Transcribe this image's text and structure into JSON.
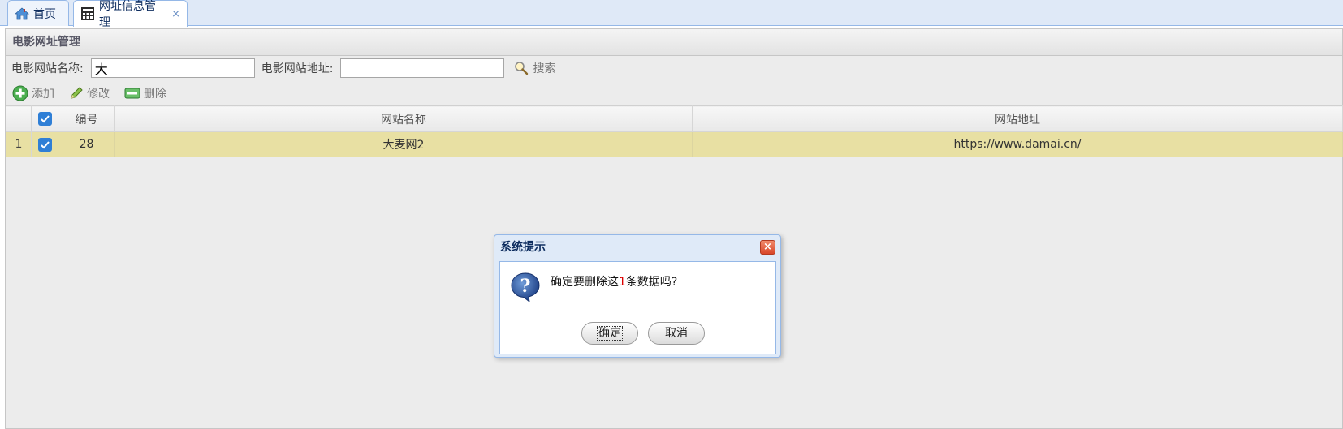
{
  "tabs": [
    {
      "label": "首页",
      "icon": "home-icon"
    },
    {
      "label": "网址信息管理",
      "icon": "grid-window-icon",
      "closable": "×"
    }
  ],
  "panel": {
    "title": "电影网址管理"
  },
  "search": {
    "name_label": "电影网站名称:",
    "name_value": "大",
    "url_label": "电影网站地址:",
    "url_value": "",
    "button_label": "搜索"
  },
  "toolbar": {
    "add_label": "添加",
    "edit_label": "修改",
    "delete_label": "删除"
  },
  "table": {
    "columns": [
      "编号",
      "网站名称",
      "网站地址"
    ],
    "rows": [
      {
        "rownum": "1",
        "checked": true,
        "id": "28",
        "name": "大麦网2",
        "url": "https://www.damai.cn/"
      }
    ]
  },
  "dialog": {
    "title": "系统提示",
    "close_label": "×",
    "message_pre": "确定要删除这",
    "message_count": "1",
    "message_post": "条数据吗?",
    "ok_label": "确定",
    "cancel_label": "取消"
  },
  "colors": {
    "selected_row": "#e8e0a3",
    "accent": "#95b8e7",
    "checkbox": "#2f7fd6"
  }
}
